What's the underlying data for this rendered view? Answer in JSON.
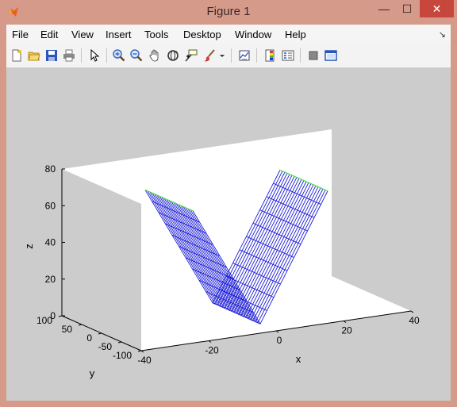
{
  "window": {
    "title": "Figure 1",
    "minimize": "—",
    "maximize": "☐",
    "close": "✕"
  },
  "menu": [
    "File",
    "Edit",
    "View",
    "Insert",
    "Tools",
    "Desktop",
    "Window",
    "Help"
  ],
  "toolbar": [
    "new-figure",
    "open-file",
    "save",
    "print",
    "select-arrow",
    "zoom-in",
    "zoom-out",
    "pan",
    "rotate-3d",
    "data-cursor",
    "brush",
    "link-plot",
    "insert-colorbar",
    "insert-legend",
    "hide-plot-tools",
    "show-plot-tools"
  ],
  "chart_data": {
    "type": "mesh",
    "xlabel": "x",
    "ylabel": "y",
    "zlabel": "z",
    "xlim": [
      -40,
      40
    ],
    "ylim": [
      -100,
      100
    ],
    "zlim": [
      0,
      80
    ],
    "x_ticks": [
      "-40",
      "-20",
      "0",
      "20",
      "40"
    ],
    "y_ticks": [
      "-100",
      "-50",
      "0",
      "50",
      "100"
    ],
    "z_ticks": [
      "0",
      "20",
      "40",
      "60",
      "80"
    ],
    "colors": {
      "mesh": "#1b1bd6",
      "edges": "#4cdc4c",
      "axes_bg": "#ffffff",
      "figure_bg": "#cccccc"
    }
  }
}
